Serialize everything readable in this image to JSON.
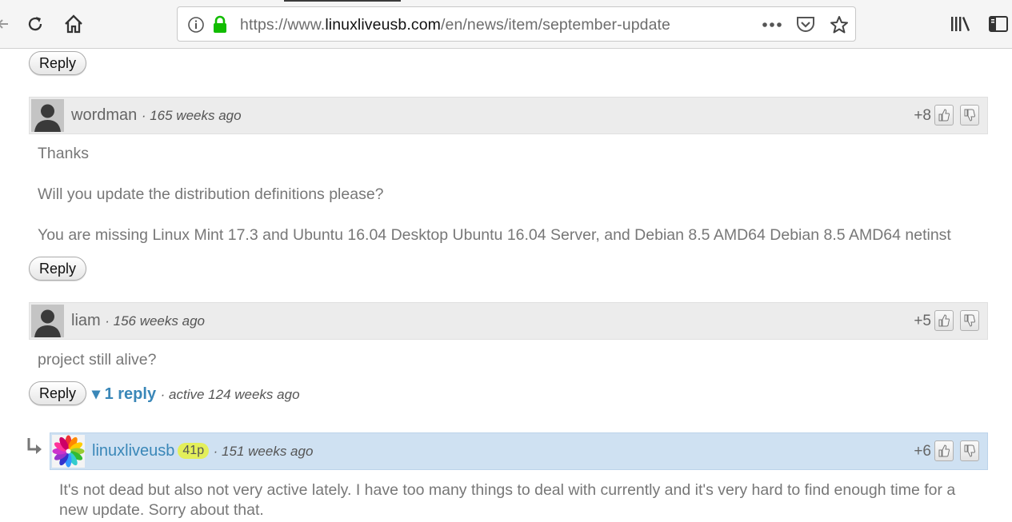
{
  "browser": {
    "url_prefix": "https://www.",
    "url_domain": "linuxliveusb.com",
    "url_path": "/en/news/item/september-update",
    "icons": [
      "back-icon",
      "reload-icon",
      "home-icon",
      "info-icon",
      "lock-icon",
      "page-actions-icon",
      "pocket-icon",
      "bookmark-star-icon",
      "library-icon",
      "sidebar-icon"
    ]
  },
  "colors": {
    "link": "#3a87b8",
    "badge": "#e3ef5a",
    "highlight_header": "#cfe1f2"
  },
  "reply_label": "Reply",
  "comments": [
    {
      "author": "wordman",
      "time": "· 165 weeks ago",
      "score": "+8",
      "paragraphs": [
        "Thanks",
        "Will you update the distribution definitions please?",
        "You are missing Linux Mint 17.3 and Ubuntu 16.04 Desktop Ubuntu 16.04 Server, and Debian 8.5 AMD64 Debian 8.5 AMD64 netinst"
      ]
    },
    {
      "author": "liam",
      "time": "· 156 weeks ago",
      "score": "+5",
      "paragraphs": [
        "project still alive?"
      ],
      "replies_toggle": "▾ 1 reply",
      "replies_active": "· active 124 weeks ago"
    },
    {
      "author": "linuxliveusb",
      "badge": "41p",
      "time": "· 151 weeks ago",
      "score": "+6",
      "paragraphs": [
        "It's not dead but also not very active lately. I have too many things to deal with currently and it's very hard to find enough time for a new update. Sorry about that."
      ]
    }
  ]
}
